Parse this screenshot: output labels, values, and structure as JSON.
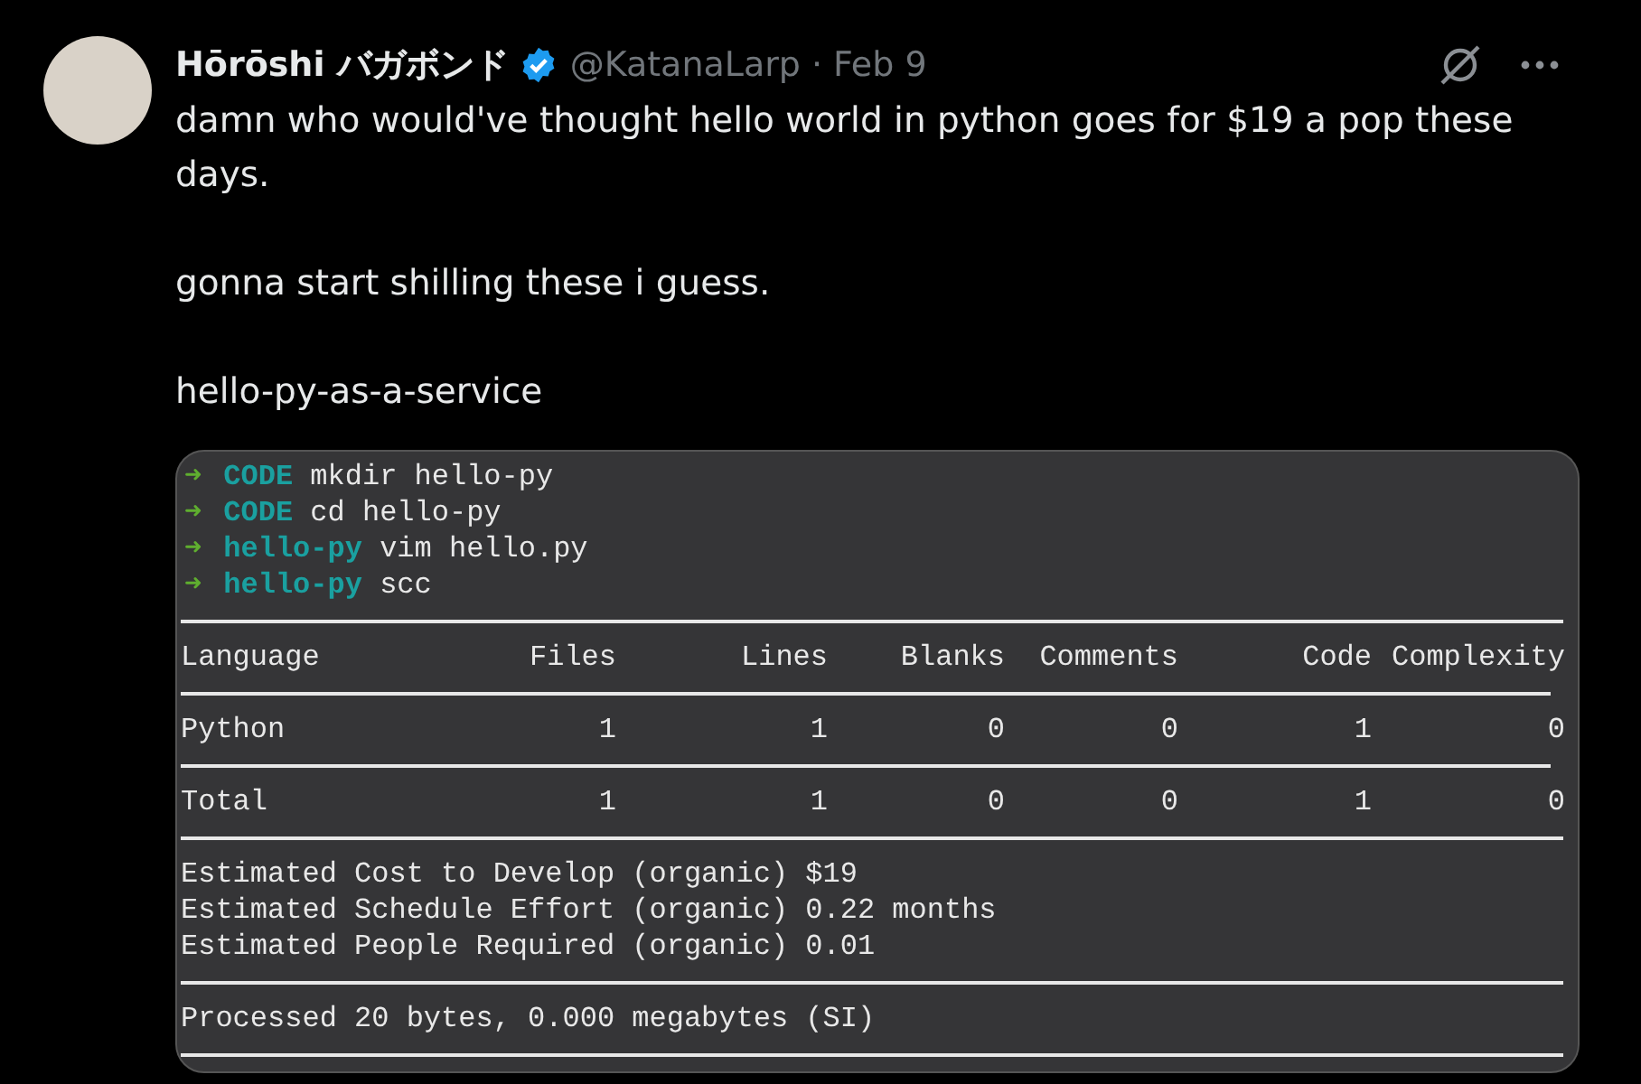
{
  "author": {
    "name": "Hōrōshi バガボンド",
    "handle": "@KatanaLarp",
    "separator": "·",
    "date": "Feb 9"
  },
  "text": [
    "damn who would've thought hello world in python goes for $19 a pop these days.",
    "gonna start shilling these i guess.",
    "hello-py-as-a-service"
  ],
  "terminal": {
    "prompts": [
      {
        "symbol": "➜",
        "dir": "CODE",
        "command": "mkdir hello-py"
      },
      {
        "symbol": "➜",
        "dir": "CODE",
        "command": "cd hello-py"
      },
      {
        "symbol": "➜",
        "dir": "hello-py",
        "command": "vim hello.py"
      },
      {
        "symbol": "➜",
        "dir": "hello-py",
        "command": "scc"
      }
    ],
    "table": {
      "columns": [
        "Language",
        "Files",
        "Lines",
        "Blanks",
        "Comments",
        "Code",
        "Complexity"
      ],
      "rows": [
        [
          "Python",
          "1",
          "1",
          "0",
          "0",
          "1",
          "0"
        ],
        [
          "Total",
          "1",
          "1",
          "0",
          "0",
          "1",
          "0"
        ]
      ]
    },
    "estimates": [
      "Estimated Cost to Develop (organic) $19",
      "Estimated Schedule Effort (organic) 0.22 months",
      "Estimated People Required (organic) 0.01"
    ],
    "summary": "Processed 20 bytes, 0.000 megabytes (SI)"
  }
}
